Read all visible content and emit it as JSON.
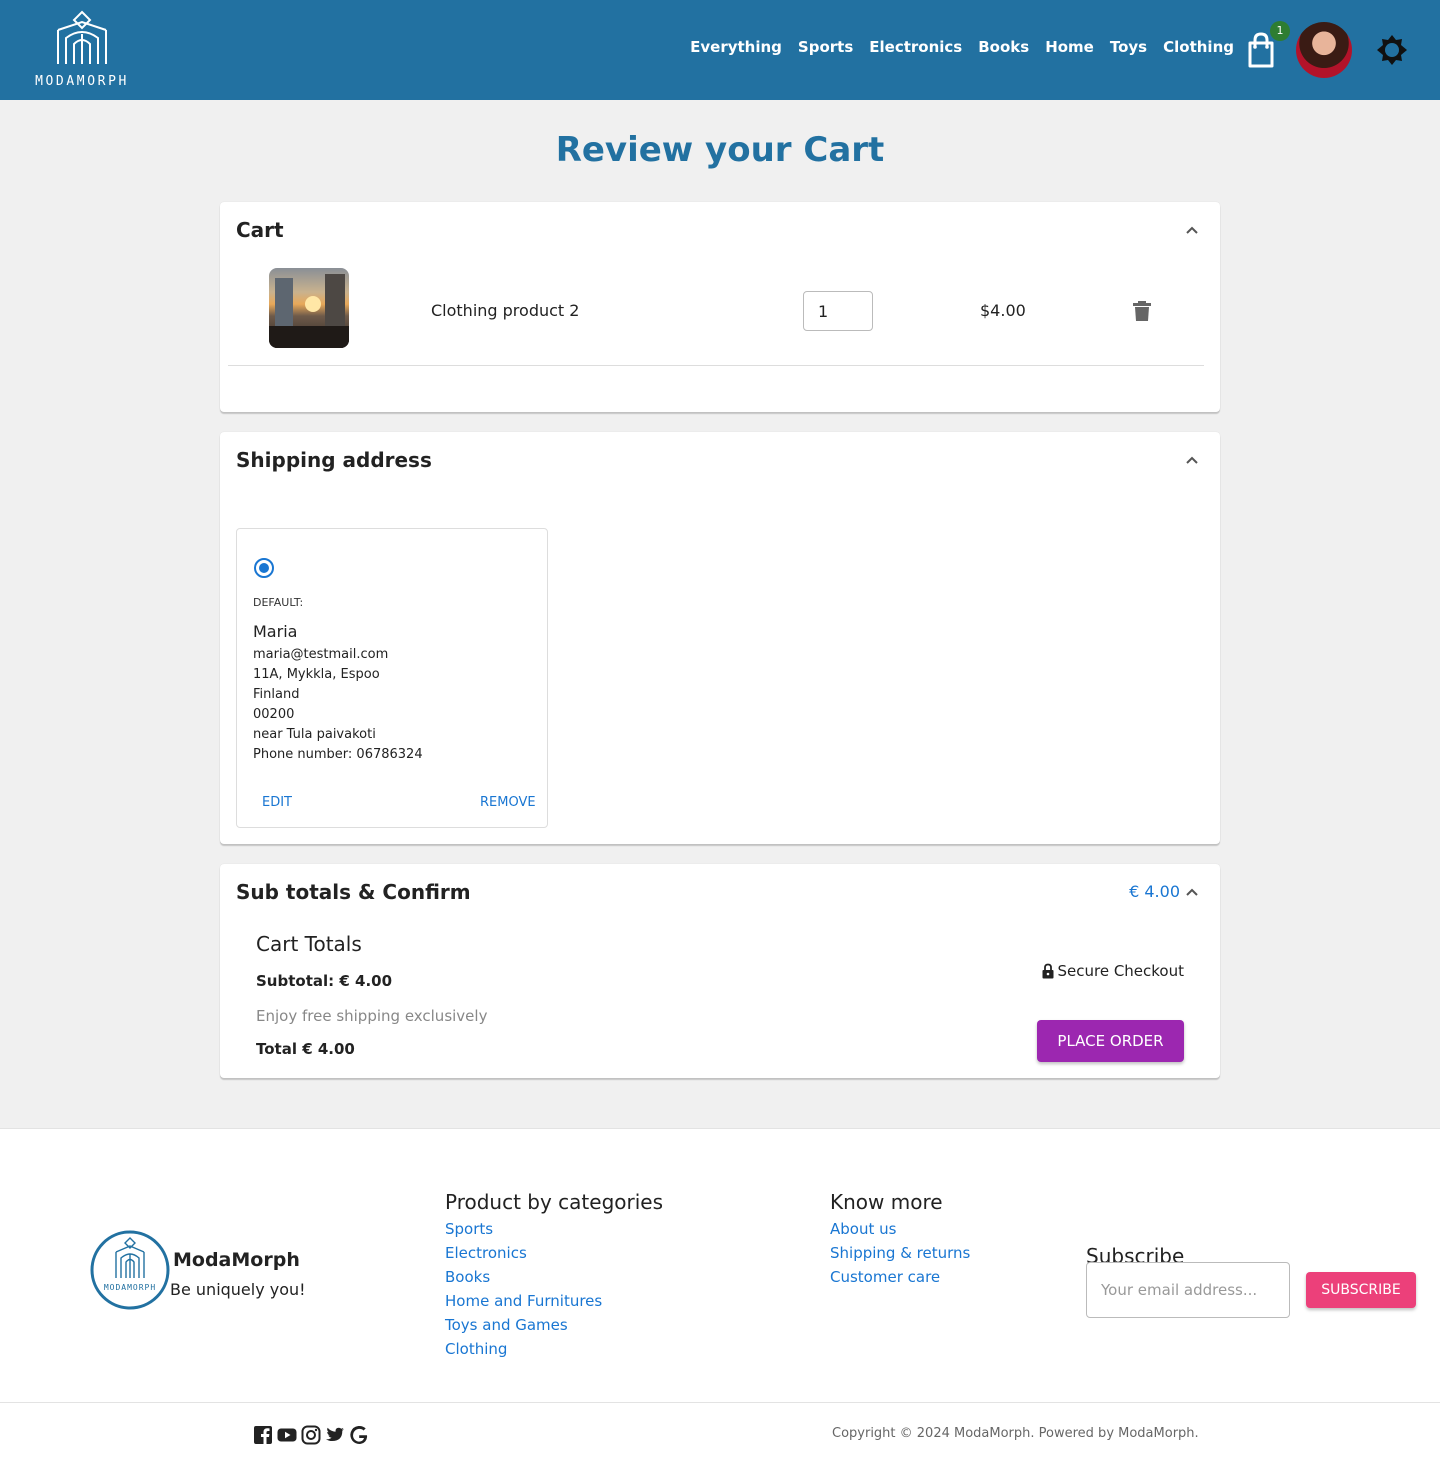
{
  "header": {
    "logo_text": "MODAMORPH",
    "nav": [
      "Everything",
      "Sports",
      "Electronics",
      "Books",
      "Home",
      "Toys",
      "Clothing"
    ],
    "cart_count": "1",
    "icons": [
      "shopping-bag-icon",
      "avatar",
      "sun-icon"
    ]
  },
  "page": {
    "title": "Review your Cart"
  },
  "cart": {
    "title": "Cart",
    "items": [
      {
        "name": "Clothing product 2",
        "quantity": "1",
        "price": "$4.00"
      }
    ]
  },
  "shipping": {
    "title": "Shipping address",
    "address": {
      "label": "DEFAULT:",
      "name": "Maria",
      "email": "maria@testmail.com",
      "street": "11A, Mykkla, Espoo",
      "country": "Finland",
      "zip": "00200",
      "landmark": "near Tula paivakoti",
      "phone": "Phone number: 06786324",
      "edit_label": "EDIT",
      "remove_label": "REMOVE"
    }
  },
  "totals": {
    "title": "Sub totals & Confirm",
    "amount": "€ 4.00",
    "cart_totals": "Cart Totals",
    "subtotal": "Subtotal: € 4.00",
    "shipping_note": "Enjoy free shipping exclusively",
    "total": "Total € 4.00",
    "secure": "Secure Checkout",
    "place_order": "PLACE ORDER"
  },
  "footer": {
    "logo_text": "MODAMORPH",
    "brand": "ModaMorph",
    "tagline": "Be uniquely you!",
    "categories_title": "Product by categories",
    "categories": [
      "Sports",
      "Electronics",
      "Books",
      "Home and Furnitures",
      "Toys and Games",
      "Clothing"
    ],
    "know_title": "Know more",
    "know_links": [
      "About us",
      "Shipping & returns",
      "Customer care"
    ],
    "subscribe_title": "Subscribe",
    "email_placeholder": "Your email address...",
    "subscribe_button": "SUBSCRIBE",
    "socials": [
      "facebook-icon",
      "youtube-icon",
      "instagram-icon",
      "twitter-icon",
      "google-icon"
    ],
    "copyright": "Copyright © 2024 ModaMorph. Powered by ModaMorph."
  },
  "colors": {
    "header_bg": "#2271a1",
    "accent_blue": "#1976d2",
    "place_order": "#9c27b0",
    "subscribe": "#ec407a",
    "badge": "#2e7d32"
  }
}
